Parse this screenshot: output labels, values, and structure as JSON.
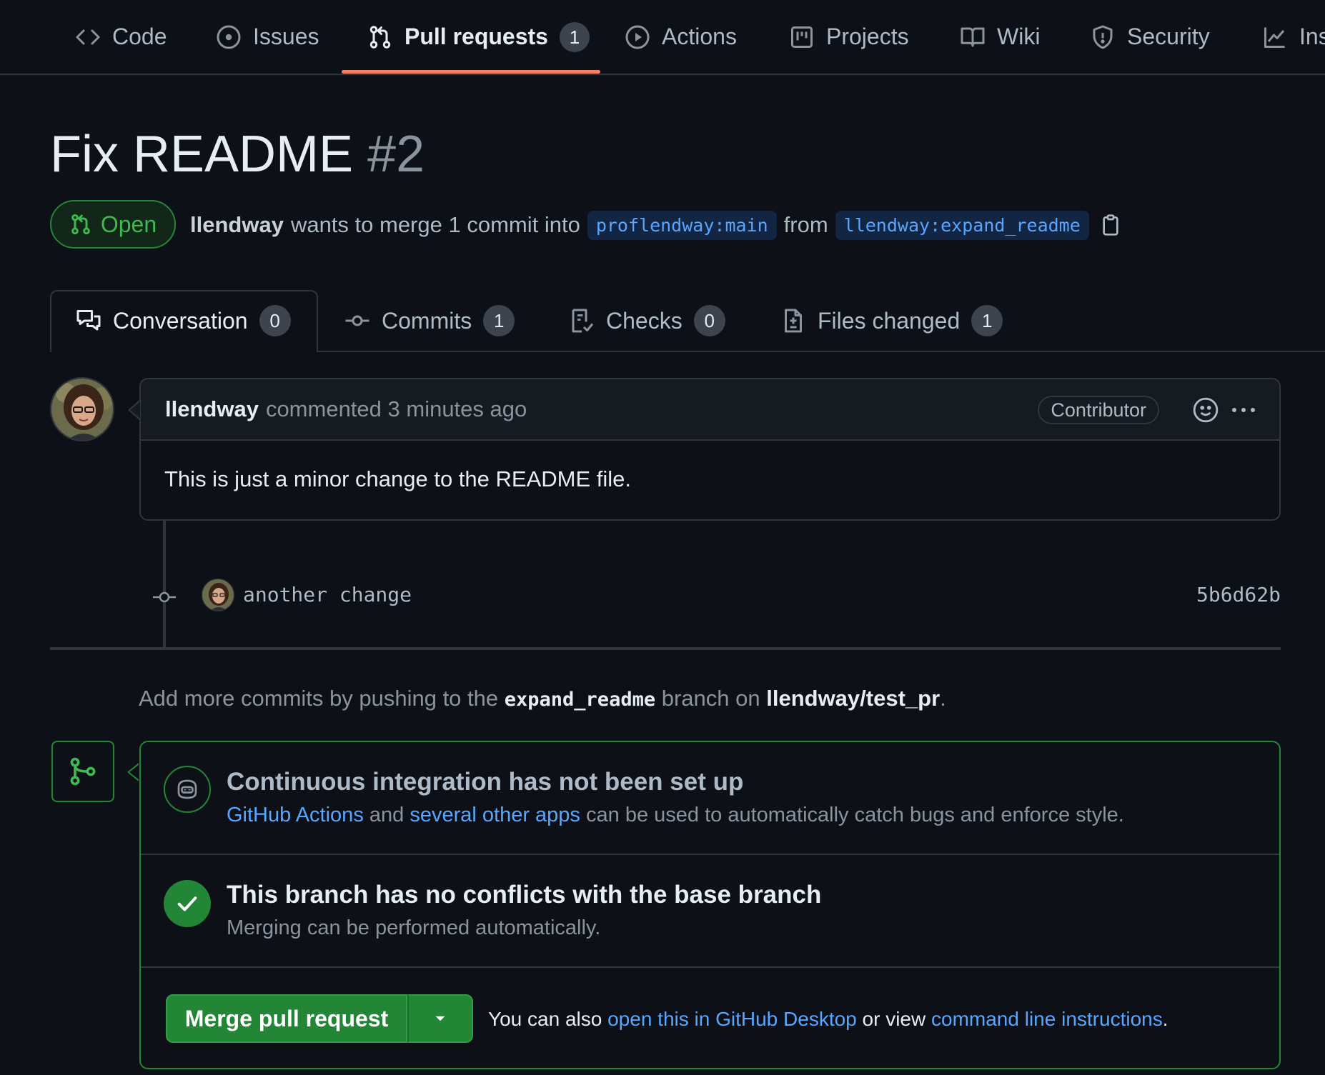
{
  "nav": {
    "items": [
      {
        "label": "Code",
        "icon": "code-icon"
      },
      {
        "label": "Issues",
        "icon": "issue-opened-icon"
      },
      {
        "label": "Pull requests",
        "icon": "git-pull-request-icon",
        "count": "1",
        "active": true
      },
      {
        "label": "Actions",
        "icon": "play-icon"
      },
      {
        "label": "Projects",
        "icon": "project-icon"
      },
      {
        "label": "Wiki",
        "icon": "book-icon"
      },
      {
        "label": "Security",
        "icon": "shield-icon"
      },
      {
        "label": "Ins",
        "icon": "graph-icon"
      }
    ]
  },
  "pr": {
    "title": "Fix README",
    "number": "#2",
    "state": "Open",
    "author": "llendway",
    "merge_text": "wants to merge 1 commit into",
    "base_branch": "proflendway:main",
    "from_text": "from",
    "head_branch": "llendway:expand_readme"
  },
  "tabs": [
    {
      "label": "Conversation",
      "count": "0",
      "icon": "comment-discussion-icon",
      "active": true
    },
    {
      "label": "Commits",
      "count": "1",
      "icon": "git-commit-icon"
    },
    {
      "label": "Checks",
      "count": "0",
      "icon": "checklist-icon"
    },
    {
      "label": "Files changed",
      "count": "1",
      "icon": "file-diff-icon"
    }
  ],
  "comment": {
    "author": "llendway",
    "action": "commented 3 minutes ago",
    "role": "Contributor",
    "body": "This is just a minor change to the README file."
  },
  "commit": {
    "message": "another change",
    "sha": "5b6d62b"
  },
  "push_note": {
    "prefix": "Add more commits by pushing to the",
    "branch": "expand_readme",
    "middle": "branch on",
    "repo": "llendway/test_pr",
    "suffix": "."
  },
  "merge_box": {
    "ci_title": "Continuous integration has not been set up",
    "ci_link1": "GitHub Actions",
    "ci_and": "and",
    "ci_link2": "several other apps",
    "ci_rest": "can be used to automatically catch bugs and enforce style.",
    "conflict_title": "This branch has no conflicts with the base branch",
    "conflict_sub": "Merging can be performed automatically.",
    "merge_button": "Merge pull request",
    "alt_prefix": "You can also",
    "alt_link1": "open this in GitHub Desktop",
    "alt_middle": "or view",
    "alt_link2": "command line instructions",
    "alt_suffix": "."
  },
  "colors": {
    "background": "#0d1117",
    "accent_underline": "#f78166",
    "open_green": "#3fb950",
    "merge_green": "#238636",
    "link_blue": "#58a6ff"
  }
}
